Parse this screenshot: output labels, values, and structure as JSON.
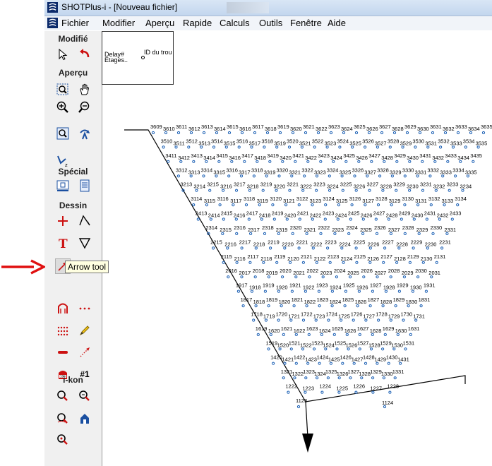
{
  "window": {
    "title": "SHOTPlus-i - [Nouveau fichier]"
  },
  "menu": {
    "items": [
      "Fichier",
      "Modifier",
      "Aperçu",
      "Rapide",
      "Calculs",
      "Outils",
      "Fenêtre",
      "Aide"
    ]
  },
  "toolbox": {
    "sections": {
      "modifie": "Modifié",
      "apercu": "Aperçu",
      "special": "Spécial",
      "dessin": "Dessin",
      "ikon": "i-kon"
    },
    "tools": [
      {
        "name": "select-pointer-icon",
        "selected": false
      },
      {
        "name": "undo-icon",
        "selected": false
      },
      {
        "name": "zoom-window-icon",
        "selected": false
      },
      {
        "name": "pan-hand-icon",
        "selected": false
      },
      {
        "name": "zoom-in-icon",
        "selected": false
      },
      {
        "name": "zoom-out-icon",
        "selected": false
      },
      {
        "name": "zoom-extents-icon",
        "selected": false
      },
      {
        "name": "rotate-view-icon",
        "selected": false
      },
      {
        "name": "rotate-z-icon",
        "selected": false
      },
      {
        "name": "special-tool-1-icon",
        "selected": false
      },
      {
        "name": "special-tool-2-icon",
        "selected": false
      },
      {
        "name": "plus-tool-icon",
        "selected": false
      },
      {
        "name": "polyline-tool-icon",
        "selected": false
      },
      {
        "name": "text-tool-icon",
        "selected": false
      },
      {
        "name": "triangle-tool-icon",
        "selected": false
      },
      {
        "name": "arrow-tool-icon",
        "selected": true
      },
      {
        "name": "hole-tool-icon",
        "selected": false
      },
      {
        "name": "dotted-line-tool-icon",
        "selected": false
      },
      {
        "name": "hole-pattern-icon",
        "selected": false
      },
      {
        "name": "pencil-tool-icon",
        "selected": false
      },
      {
        "name": "line-segment-icon",
        "selected": false
      },
      {
        "name": "dotted-arrow-icon",
        "selected": false
      },
      {
        "name": "detonator-icon",
        "selected": false
      },
      {
        "name": "numbering-icon",
        "selected": false
      },
      {
        "name": "ikon-tool-1-icon",
        "selected": false
      },
      {
        "name": "ikon-tool-2-icon",
        "selected": false
      },
      {
        "name": "ikon-tool-3-icon",
        "selected": false
      },
      {
        "name": "ikon-tool-4-icon",
        "selected": false
      },
      {
        "name": "ikon-tool-5-icon",
        "selected": false
      }
    ],
    "numbering_label": "#1"
  },
  "tooltip": "Arrow tool",
  "legend": {
    "line1": "Delay#",
    "line2": "Etages..",
    "line3": "ID du trou"
  },
  "blast_rows": [
    {
      "label_prefix": "36",
      "ids": [
        3609,
        3610,
        3611,
        3612,
        3613,
        3614,
        3615,
        3616,
        3617,
        3618,
        3619,
        3620,
        3621,
        3622,
        3623,
        3624,
        3625,
        3626,
        3627,
        3628,
        3629,
        3630,
        3631,
        3632,
        3633,
        3634,
        3635
      ]
    },
    {
      "label_prefix": "35",
      "ids": [
        3510,
        3511,
        3512,
        3513,
        3514,
        3515,
        3516,
        3517,
        3518,
        3519,
        3520,
        3521,
        3522,
        3523,
        3524,
        3525,
        3526,
        3527,
        3528,
        3529,
        3530,
        3531,
        3532,
        3533,
        3534,
        3535
      ]
    },
    {
      "label_prefix": "34",
      "ids": [
        3411,
        3412,
        3413,
        3414,
        3415,
        3416,
        3417,
        3418,
        3419,
        3420,
        3421,
        3422,
        3423,
        3424,
        3425,
        3426,
        3427,
        3428,
        3429,
        3430,
        3431,
        3432,
        3433,
        3434,
        3435
      ]
    },
    {
      "label_prefix": "33",
      "ids": [
        3312,
        3313,
        3314,
        3315,
        3316,
        3317,
        3318,
        3319,
        3320,
        3321,
        3322,
        3323,
        3324,
        3325,
        3326,
        3327,
        3328,
        3329,
        3330,
        3331,
        3332,
        3333,
        3334,
        3335
      ]
    },
    {
      "label_prefix": "32",
      "ids": [
        3213,
        3214,
        3215,
        3216,
        3217,
        3218,
        3219,
        3220,
        3221,
        3222,
        3223,
        3224,
        3225,
        3226,
        3227,
        3228,
        3229,
        3230,
        3231,
        3232,
        3233,
        3234
      ]
    },
    {
      "label_prefix": "31",
      "ids": [
        3114,
        3115,
        3116,
        3117,
        3118,
        3119,
        3120,
        3121,
        3122,
        3123,
        3124,
        3125,
        3126,
        3127,
        3128,
        3129,
        3130,
        3131,
        3132,
        3133,
        3134
      ]
    },
    {
      "label_prefix": "24",
      "ids": [
        2413,
        2414,
        2415,
        2416,
        2417,
        2418,
        2419,
        2420,
        2421,
        2422,
        2423,
        2424,
        2425,
        2426,
        2427,
        2428,
        2429,
        2430,
        2431,
        2432,
        2433
      ]
    },
    {
      "label_prefix": "23",
      "ids": [
        2314,
        2315,
        2316,
        2317,
        2318,
        2319,
        2320,
        2321,
        2322,
        2323,
        2324,
        2325,
        2326,
        2327,
        2328,
        2329,
        2330,
        2331
      ]
    },
    {
      "label_prefix": "22",
      "ids": [
        2215,
        2216,
        2217,
        2218,
        2219,
        2220,
        2221,
        2222,
        2223,
        2224,
        2225,
        2226,
        2227,
        2228,
        2229,
        2230,
        2231
      ]
    },
    {
      "label_prefix": "21",
      "ids": [
        2115,
        2116,
        2117,
        2118,
        2119,
        2120,
        2121,
        2122,
        2123,
        2124,
        2125,
        2126,
        2127,
        2128,
        2129,
        2130,
        2131
      ]
    },
    {
      "label_prefix": "20",
      "ids": [
        2016,
        2017,
        2018,
        2019,
        2020,
        2021,
        2022,
        2023,
        2024,
        2025,
        2026,
        2027,
        2028,
        2029,
        2030,
        2031
      ]
    },
    {
      "label_prefix": "19",
      "ids": [
        1917,
        1918,
        1919,
        1920,
        1921,
        1922,
        1923,
        1924,
        1925,
        1926,
        1927,
        1928,
        1929,
        1930,
        1931
      ]
    },
    {
      "label_prefix": "18",
      "ids": [
        1817,
        1818,
        1819,
        1820,
        1821,
        1822,
        1823,
        1824,
        1825,
        1826,
        1827,
        1828,
        1829,
        1830,
        1831
      ]
    },
    {
      "label_prefix": "17",
      "ids": [
        1718,
        1719,
        1720,
        1721,
        1722,
        1723,
        1724,
        1725,
        1726,
        1727,
        1728,
        1729,
        1730,
        1731
      ]
    },
    {
      "label_prefix": "16",
      "ids": [
        1619,
        1620,
        1621,
        1622,
        1623,
        1624,
        1625,
        1626,
        1627,
        1628,
        1629,
        1630,
        1631
      ]
    },
    {
      "label_prefix": "15",
      "ids": [
        1519,
        1520,
        1521,
        1522,
        1523,
        1524,
        1525,
        1526,
        1527,
        1528,
        1529,
        1530,
        1531
      ]
    },
    {
      "label_prefix": "14",
      "ids": [
        1420,
        1421,
        1422,
        1423,
        1424,
        1425,
        1426,
        1427,
        1428,
        1429,
        1430,
        1431
      ]
    },
    {
      "label_prefix": "13",
      "ids": [
        1321,
        1322,
        1323,
        1324,
        1325,
        1326,
        1327,
        1328,
        1329,
        1330,
        1331
      ]
    },
    {
      "label_prefix": "12",
      "ids": [
        1222,
        1223,
        1224,
        1225,
        1226,
        1227,
        1228
      ]
    },
    {
      "label_prefix": "11",
      "ids": [
        1123,
        1124
      ]
    }
  ],
  "colors": {
    "hole": "#1a5fb4",
    "label": "#000000",
    "red_indicator": "#e01010",
    "tool_red": "#cc1111",
    "tool_blue": "#1a4fa0"
  }
}
